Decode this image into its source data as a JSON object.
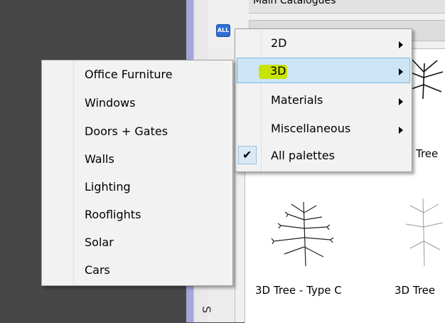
{
  "panel": {
    "top_bar_text": "Main Catalogues",
    "all_icon_label": "ALL",
    "side_tab_label": "S",
    "thumbnails": [
      {
        "label": "3D Tree - Type C"
      },
      {
        "label": "3D Tree"
      },
      {
        "label": "Tree"
      }
    ]
  },
  "context_menu": {
    "items": [
      {
        "label": "2D",
        "has_submenu": true,
        "highlighted": false,
        "checked": false
      },
      {
        "label": "3D",
        "has_submenu": true,
        "highlighted": true,
        "checked": false
      },
      {
        "label": "Materials",
        "has_submenu": true,
        "highlighted": false,
        "checked": false
      },
      {
        "label": "Miscellaneous",
        "has_submenu": true,
        "highlighted": false,
        "checked": false
      },
      {
        "label": "All palettes",
        "has_submenu": false,
        "highlighted": false,
        "checked": true
      }
    ],
    "checkmark_glyph": "✔"
  },
  "submenu_3d": {
    "items": [
      "Office Furniture",
      "Windows",
      "Doors + Gates",
      "Walls",
      "Lighting",
      "Rooflights",
      "Solar",
      "Cars"
    ]
  },
  "colors": {
    "highlight_bg": "#cde6f7",
    "highlight_border": "#7cb6e3",
    "annotation_marker": "#c8e400",
    "left_background": "#474747"
  }
}
